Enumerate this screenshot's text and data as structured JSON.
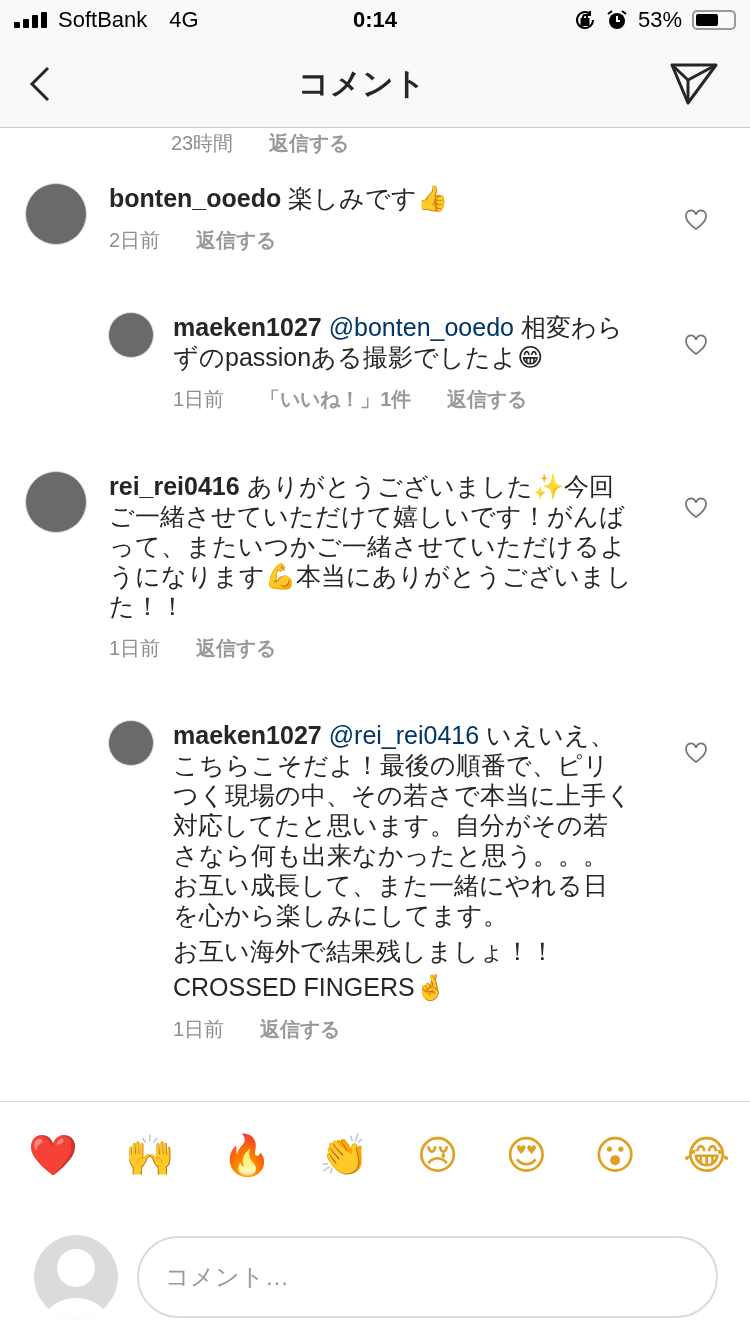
{
  "status_bar": {
    "carrier": "SoftBank",
    "network": "4G",
    "time": "0:14",
    "battery": "53%"
  },
  "header": {
    "title": "コメント"
  },
  "partial_meta": {
    "time": "23時間",
    "reply": "返信する"
  },
  "comments": [
    {
      "kind": "comment",
      "username": "bonten_ooedo",
      "paragraphs": [
        "楽しみです👍"
      ],
      "time": "2日前",
      "reply": "返信する",
      "liked": false
    },
    {
      "kind": "reply",
      "username": "maeken1027",
      "mention": "@bonten_ooedo",
      "paragraphs": [
        "相変わらずのpassionある撮影でしたよ😁"
      ],
      "time": "1日前",
      "likes": "「いいね！」1件",
      "reply": "返信する",
      "liked": false
    },
    {
      "kind": "comment",
      "username": "rei_rei0416",
      "paragraphs": [
        "ありがとうございました✨今回ご一緒させていただけて嬉しいです！がんばって、またいつかご一緒させていただけるようになります💪本当にありがとうございました！！"
      ],
      "time": "1日前",
      "reply": "返信する",
      "liked": false
    },
    {
      "kind": "reply",
      "username": "maeken1027",
      "mention": "@rei_rei0416",
      "paragraphs": [
        "いえいえ、こちらこそだよ！最後の順番で、ピリつく現場の中、その若さで本当に上手く対応してたと思います。自分がその若さなら何も出来なかったと思う。。。お互い成長して、また一緒にやれる日を心から楽しみにしてます。",
        "お互い海外で結果残しましょ！！",
        "CROSSED FINGERS🤞"
      ],
      "time": "1日前",
      "reply": "返信する",
      "liked": false
    }
  ],
  "emoji_bar": [
    "❤️",
    "🙌",
    "🔥",
    "👏",
    "😢",
    "😍",
    "😮",
    "😂"
  ],
  "comment_input": {
    "placeholder": "コメント…"
  }
}
